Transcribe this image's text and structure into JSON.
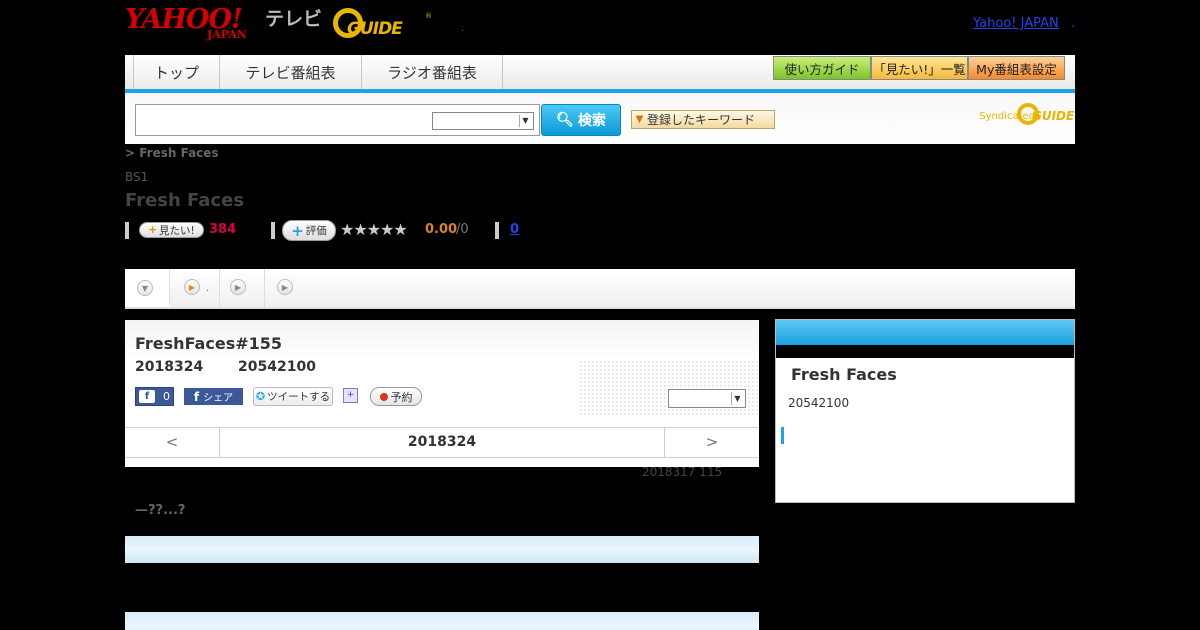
{
  "header": {
    "logo_yahoo": "YAHOO!",
    "logo_japan": "JAPAN",
    "logo_tv": "テレビ",
    "logo_guide": "GUIDE",
    "logo_reg": "®",
    "dot": ".",
    "yahoo_link": "Yahoo! JAPAN",
    "yahoo_dot": "."
  },
  "nav": {
    "tabs": [
      "トップ",
      "テレビ番組表",
      "ラジオ番組表"
    ],
    "right_buttons": [
      "使い方ガイド",
      "「見たい!」一覧",
      "My番組表設定"
    ]
  },
  "search": {
    "input_value": "",
    "select_value": "",
    "button_label": "検索",
    "keyword_button": "登録したキーワード",
    "syndicated": "Syndicated",
    "guide": "GUIDE"
  },
  "program": {
    "breadcrumb": "> Fresh Faces",
    "channel": "BS1",
    "title": "Fresh Faces",
    "want_label": "見たい!",
    "want_count": "384",
    "eval_label": "評価",
    "stars": "★★★★★",
    "score": "0.00",
    "score_den": "/0",
    "count_link": "0"
  },
  "detail_tabs": {
    "b_dot": "."
  },
  "episode": {
    "title": "FreshFaces#155",
    "date": "2018324",
    "time": "20542100",
    "fb_like_count": "0",
    "fb_share": "シェア",
    "tweet": "ツイートする",
    "reserve": "予約",
    "select_value": "",
    "pager_prev": "<",
    "pager_current": "2018324",
    "pager_next": ">"
  },
  "previous_episode": "2018317  115",
  "description": "—??...?",
  "side": {
    "title": "Fresh Faces",
    "time": "20542100"
  },
  "colors": {
    "accent": "#1aa6e8",
    "want_count": "#d8004a",
    "score": "#d9822b",
    "link": "#2244ee",
    "brand_red": "#d40000",
    "guide_yellow": "#e8b600"
  }
}
